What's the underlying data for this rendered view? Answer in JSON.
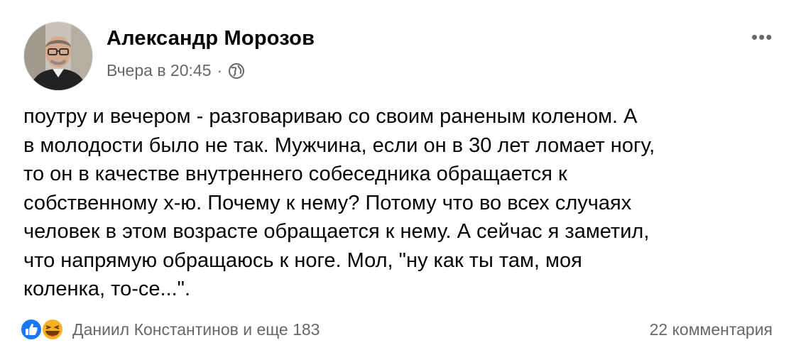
{
  "post": {
    "author": "Александр Морозов",
    "timestamp": "Вчера в 20:45",
    "separator": "·",
    "privacy_icon": "globe-icon",
    "more_label": "•••",
    "text_lines": [
      "поутру и вечером - разговариваю со своим раненым коленом. А",
      "в молодости было не так. Мужчина, если он в 30 лет ломает ногу,",
      "то он в качестве внутреннего собеседника обращается к",
      "собственному х-ю. Почему к нему? Потому что во всех случаях",
      "человек в этом возрасте обращается к нему. А сейчас я заметил,",
      "что напрямую обращаюсь к ноге. Мол, \"ну как ты там, моя",
      "коленка, то-се...\"."
    ]
  },
  "footer": {
    "reaction_icons": [
      "like-icon",
      "haha-icon"
    ],
    "reactors": "Даниил Константинов и еще 183",
    "comments": "22 комментария"
  },
  "colors": {
    "text": "#050505",
    "secondary": "#65676b",
    "like_blue": "#1877f2",
    "haha_yellow": "#f7b125"
  }
}
